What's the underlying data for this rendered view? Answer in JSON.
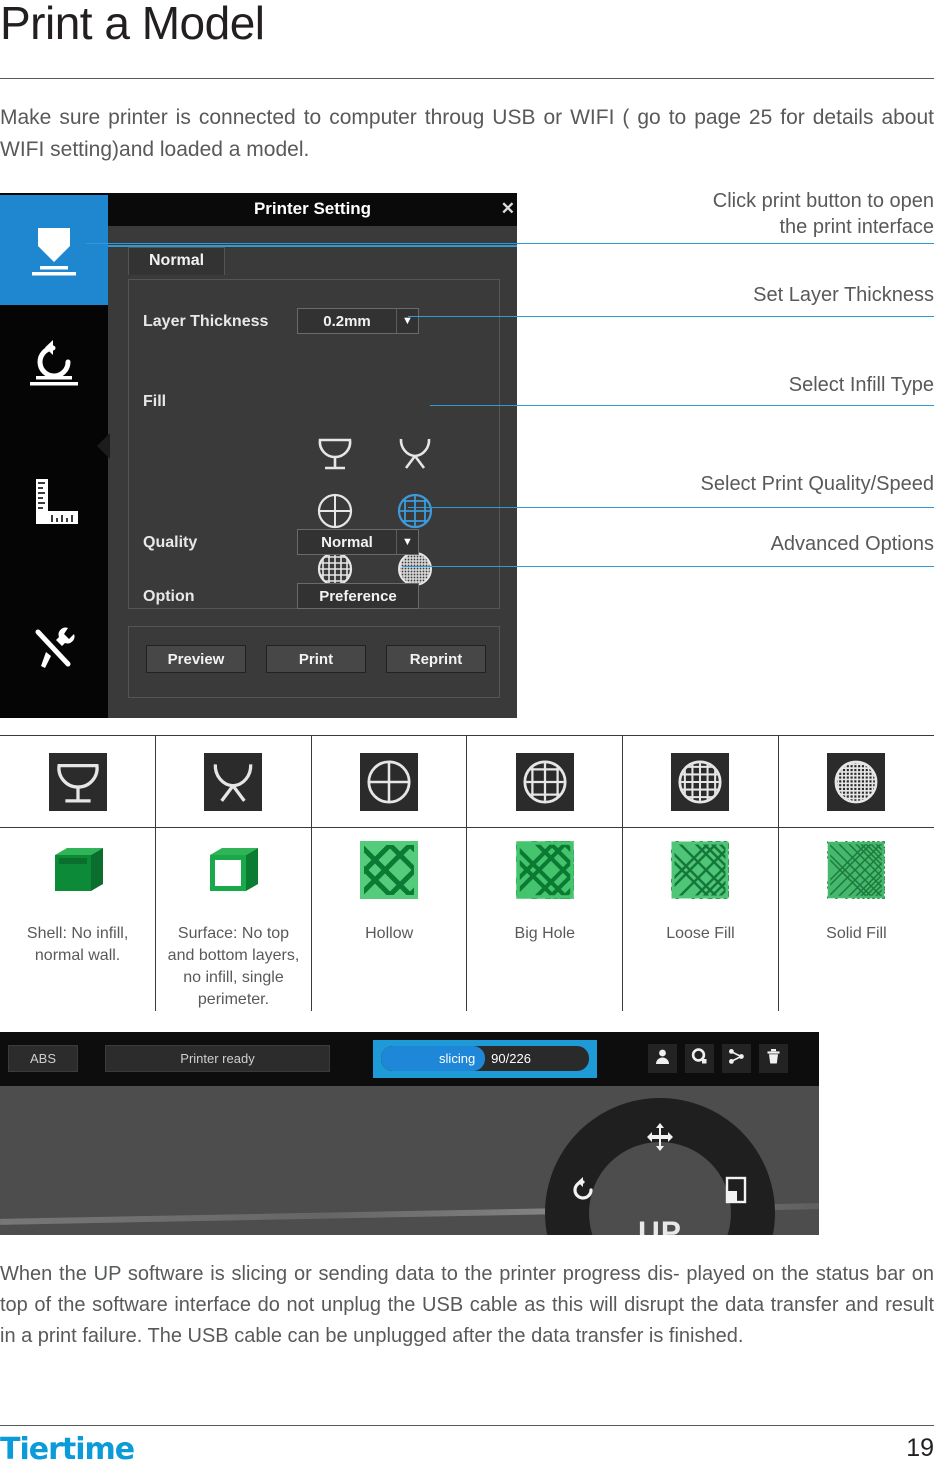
{
  "header": {
    "title": "Print a Model",
    "intro": "Make sure printer is connected to computer throug USB or WIFI ( go to page 25 for details about WIFI setting)and loaded a model."
  },
  "dialog": {
    "window_title": "Printer Setting",
    "close_label": "✕",
    "tab": "Normal",
    "layer_thickness_label": "Layer Thickness",
    "layer_thickness_value": "0.2mm",
    "fill_label": "Fill",
    "quality_label": "Quality",
    "quality_value": "Normal",
    "option_label": "Option",
    "option_value": "Preference",
    "dropdown_arrow": "▼",
    "buttons": {
      "preview": "Preview",
      "print": "Print",
      "reprint": "Reprint"
    },
    "rail_icons": [
      "print-icon",
      "rotate-reset-icon",
      "ruler-measure-icon",
      "tools-icon"
    ],
    "accent_color": "#1e87d0"
  },
  "callouts": [
    {
      "text": "Click print button to open\nthe print interface",
      "line1": "Click print button to open",
      "line2": "the print interface"
    },
    {
      "text": "Set Layer Thickness"
    },
    {
      "text": "Select Infill Type"
    },
    {
      "text": "Select Print Quality/Speed"
    },
    {
      "text": "Advanced Options"
    }
  ],
  "callout_line_color": "#2e9bd6",
  "fill_table": {
    "icon_names": [
      "shell-cup-icon",
      "surface-cup-icon",
      "hollow-circle-icon",
      "big-hole-grid-icon",
      "loose-fill-grid-icon",
      "solid-fill-grid-icon"
    ],
    "sample_names": [
      "shell-cube-sample",
      "surface-cube-sample",
      "hollow-infill-sample",
      "big-hole-infill-sample",
      "loose-fill-infill-sample",
      "solid-fill-infill-sample"
    ],
    "captions": [
      "Shell: No infill, normal wall.",
      "Surface: No top and bottom layers, no infill, single perimeter.",
      "Hollow",
      "Big Hole",
      "Loose Fill",
      "Solid Fill"
    ]
  },
  "status_bar": {
    "material": "ABS",
    "printer_status": "Printer ready",
    "progress_label": "slicing",
    "progress_value": "90/226",
    "progress_percent": 40,
    "highlight_color": "#1e9ad6",
    "icons": [
      "person-icon",
      "gear-icon",
      "share-nodes-icon",
      "trash-icon"
    ]
  },
  "viewport": {
    "brand_label": "UP",
    "tool_icons": [
      "move-icon",
      "rotate-icon",
      "scale-icon"
    ]
  },
  "note": "When the UP software is slicing or sending data to the printer progress dis- played on the status bar on top of the software interface do not unplug the USB cable as this will disrupt the data transfer and result in a print failure. The USB cable can be unplugged after the data transfer is finished.",
  "footer": {
    "brand": "Tiertime",
    "brand_color": "#0b9bd8",
    "page_number": "19"
  }
}
